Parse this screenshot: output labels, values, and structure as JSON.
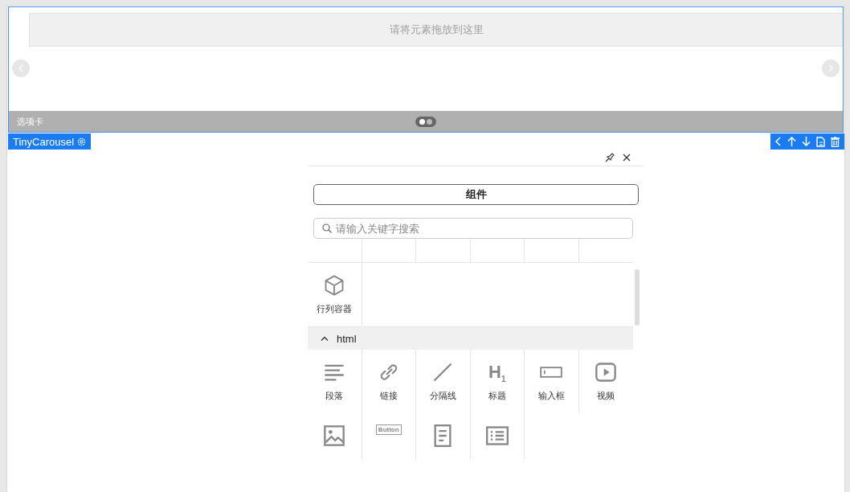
{
  "carousel": {
    "drop_hint": "请将元素拖放到这里",
    "tab_label": "选项卡",
    "indicators": [
      {
        "selected": true
      },
      {
        "selected": false
      }
    ]
  },
  "selection": {
    "component_name": "TinyCarousel"
  },
  "panel": {
    "tab": {
      "label": "组件",
      "selected": true
    },
    "search": {
      "placeholder": "请输入关键字搜索"
    },
    "groups": [
      {
        "items": [
          {
            "kind": "cube",
            "label": "行列容器"
          }
        ]
      },
      {
        "title": "html",
        "expanded": true,
        "items": [
          {
            "kind": "paragraph",
            "label": "段落"
          },
          {
            "kind": "link",
            "label": "链接"
          },
          {
            "kind": "divider",
            "label": "分隔线"
          },
          {
            "kind": "heading",
            "label": "标题",
            "icon_text": "H$_{1}$"
          },
          {
            "kind": "input",
            "label": "输入框"
          },
          {
            "kind": "video",
            "label": "视频"
          },
          {
            "kind": "image"
          },
          {
            "kind": "button",
            "icon_text": "Button"
          },
          {
            "kind": "document"
          },
          {
            "kind": "list"
          }
        ]
      }
    ]
  }
}
